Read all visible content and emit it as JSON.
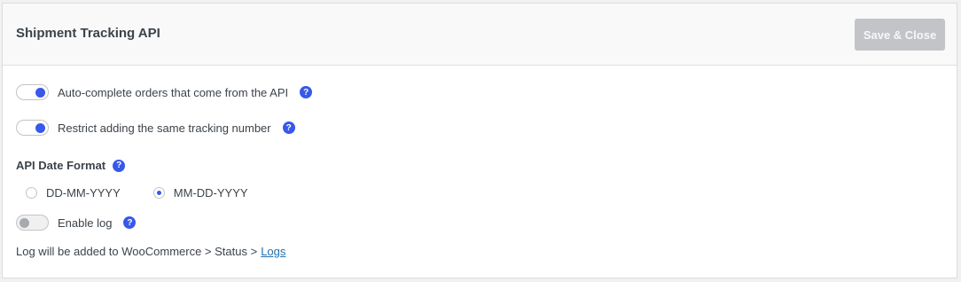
{
  "header": {
    "title": "Shipment Tracking API",
    "save_label": "Save & Close"
  },
  "settings": {
    "auto_complete": {
      "label": "Auto-complete orders that come from the API",
      "enabled": true
    },
    "restrict_duplicate": {
      "label": "Restrict adding the same tracking number",
      "enabled": true
    },
    "date_format": {
      "label": "API Date Format",
      "options": [
        {
          "label": "DD-MM-YYYY",
          "selected": false
        },
        {
          "label": "MM-DD-YYYY",
          "selected": true
        }
      ]
    },
    "enable_log": {
      "label": "Enable log",
      "enabled": false
    },
    "log_note": {
      "text": "Log will be added to WooCommerce > Status >",
      "link": "Logs"
    }
  },
  "help_glyph": "?",
  "colors": {
    "accent": "#3858e9",
    "link": "#2271b1",
    "button_disabled": "#c3c4c7"
  }
}
